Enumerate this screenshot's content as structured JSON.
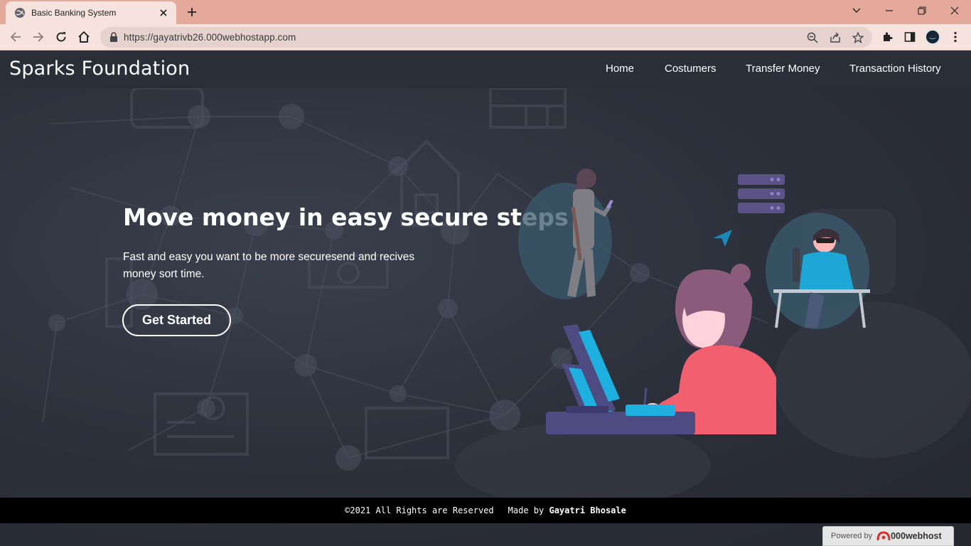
{
  "browser": {
    "tab_title": "Basic Banking System",
    "url": "https://gayatrivb26.000webhostapp.com"
  },
  "navbar": {
    "brand": "Sparks Foundation",
    "items": [
      "Home",
      "Costumers",
      "Transfer Money",
      "Transaction History"
    ]
  },
  "hero": {
    "title": "Move money in easy secure steps",
    "text": "Fast and easy you want to be more securesend and recives money sort time.",
    "cta": "Get Started"
  },
  "footer": {
    "copyright": "©2021 All Rights are Reserved",
    "made_by_prefix": "Made by",
    "author": "Gayatri Bhosale"
  },
  "badge": {
    "powered_by": "Powered by",
    "brand": "000webhost"
  },
  "colors": {
    "browser_frame": "#e4a99a",
    "page_background": "#2b2f3a",
    "accent_pink": "#f25f6f",
    "accent_blue": "#1eb1e0"
  }
}
